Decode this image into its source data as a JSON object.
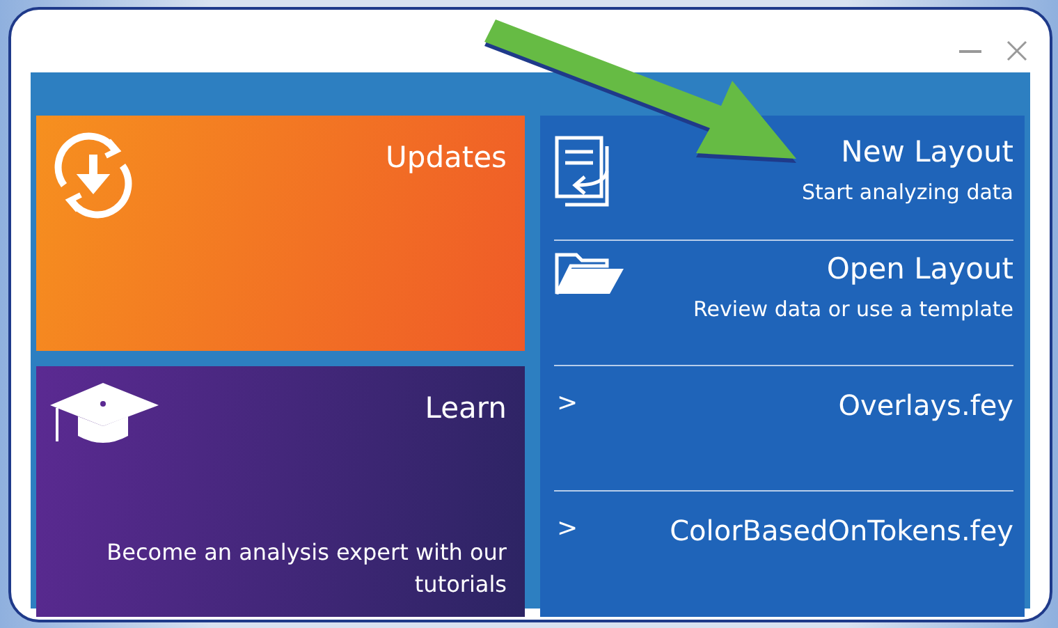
{
  "tiles": [
    {
      "kind": "updates",
      "title": "Updates"
    },
    {
      "kind": "learn",
      "title": "Learn",
      "description": "Become an analysis expert with our tutorials"
    }
  ],
  "actions": [
    {
      "kind": "new",
      "title": "New Layout",
      "subtitle": "Start analyzing data"
    },
    {
      "kind": "open",
      "title": "Open Layout",
      "subtitle": "Review data or use a template"
    }
  ],
  "recent_files": [
    {
      "marker": ">",
      "name": "Overlays.fey"
    },
    {
      "marker": ">",
      "name": "ColorBasedOnTokens.fey"
    }
  ]
}
